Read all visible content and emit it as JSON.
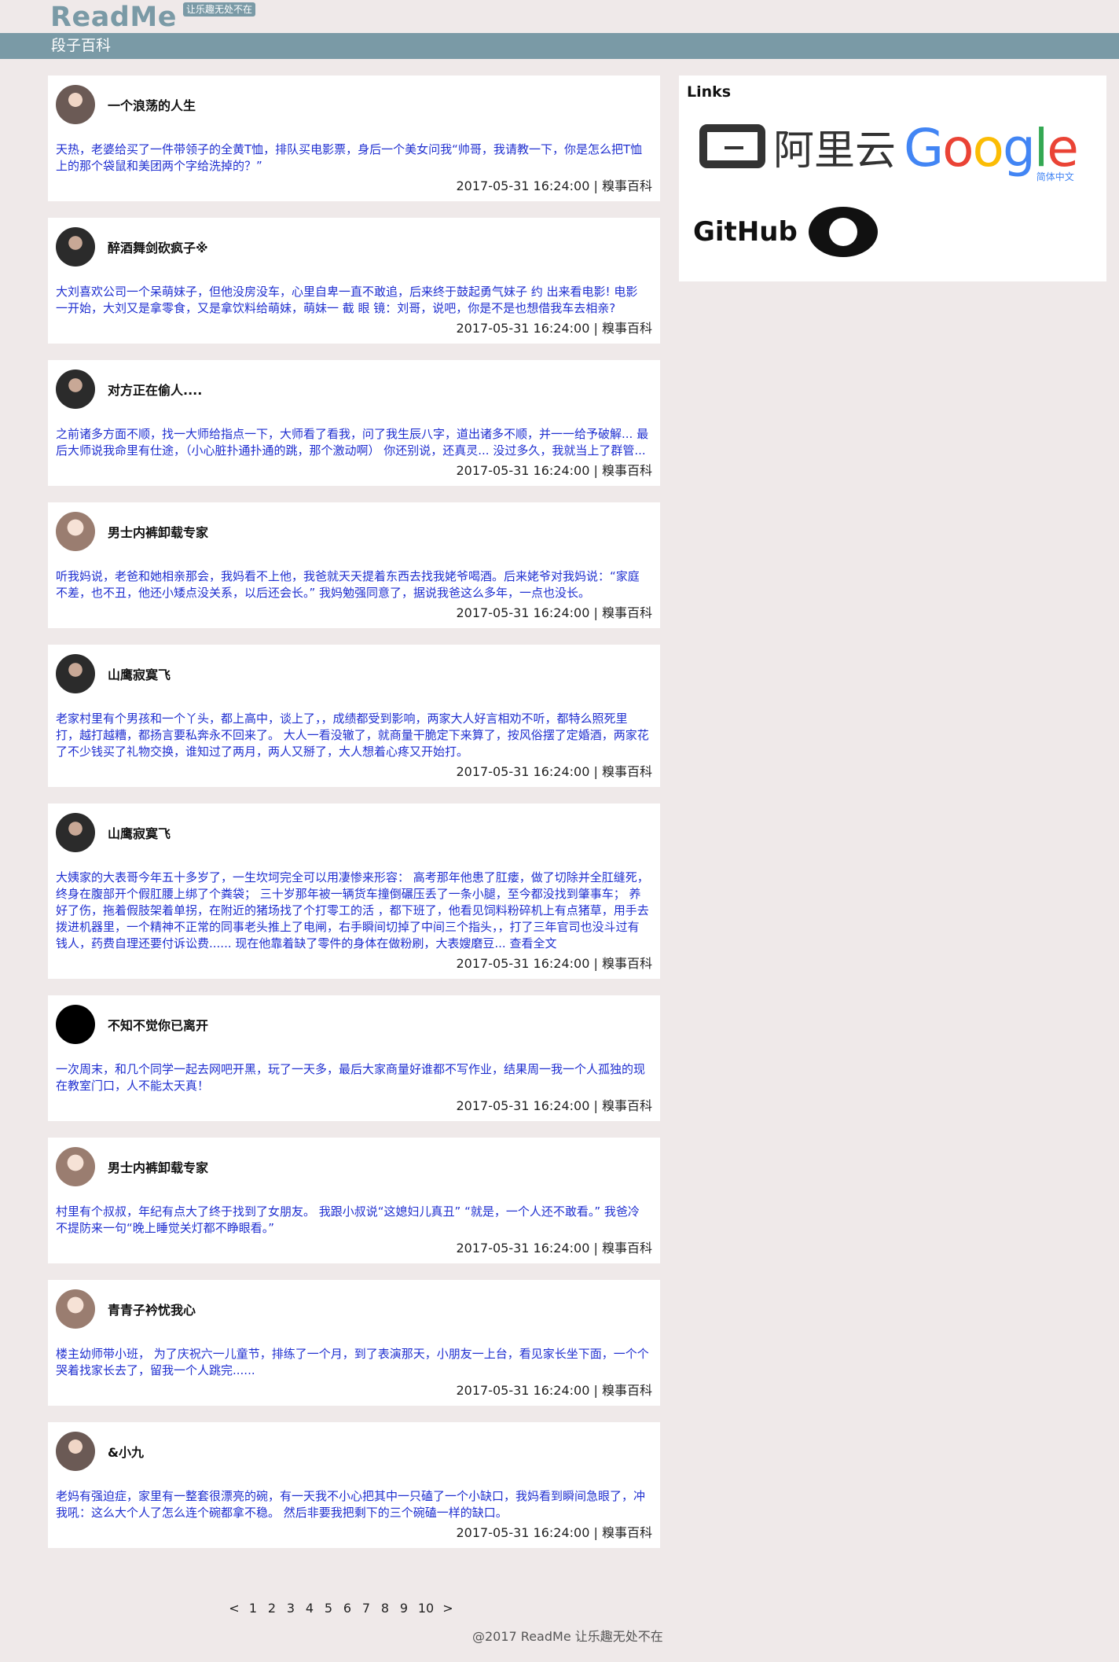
{
  "header": {
    "brand": "ReadMe",
    "slogan": "让乐趣无处不在",
    "nav_title": "段子百科"
  },
  "posts": [
    {
      "author": "一个浪荡的人生",
      "avatar": "avatar-icon",
      "content": "天热，老婆给买了一件带领子的全黄T恤，排队买电影票，身后一个美女问我“帅哥，我请教一下，你是怎么把T恤上的那个袋鼠和美团两个字给洗掉的？”",
      "time": "2017-05-31 16:24:00",
      "source": "糗事百科"
    },
    {
      "author": "醉酒舞剑砍疯子※",
      "avatar": "avatar-icon",
      "content": "大刘喜欢公司一个呆萌妹子，但他没房没车，心里自卑一直不敢追，后来终于鼓起勇气妹子 约 出来看电影! 电影一开始，大刘又是拿零食，又是拿饮料给萌妹，萌妹一 截 眼 镜：刘哥，说吧，你是不是也想借我车去相亲?",
      "time": "2017-05-31 16:24:00",
      "source": "糗事百科"
    },
    {
      "author": "对方正在偷人....",
      "avatar": "avatar-icon",
      "content": "之前诸多方面不顺，找一大师给指点一下，大师看了看我，问了我生辰八字，道出诸多不顺，并一一给予破解... 最后大师说我命里有仕途，（小心脏扑通扑通的跳，那个激动啊） 你还别说，还真灵... 没过多久，我就当上了群管...",
      "time": "2017-05-31 16:24:00",
      "source": "糗事百科"
    },
    {
      "author": "男士内裤卸载专家",
      "avatar": "avatar-icon",
      "content": "听我妈说，老爸和她相亲那会，我妈看不上他，我爸就天天提着东西去找我姥爷喝酒。后来姥爷对我妈说：“家庭不差，也不丑，他还小矮点没关系，以后还会长。” 我妈勉强同意了，据说我爸这么多年，一点也没长。",
      "time": "2017-05-31 16:24:00",
      "source": "糗事百科"
    },
    {
      "author": "山鹰寂寞飞",
      "avatar": "avatar-icon",
      "content": "老家村里有个男孩和一个丫头，都上高中，谈上了，，成绩都受到影响，两家大人好言相劝不听，都特么照死里打，越打越糟，都扬言要私奔永不回来了。 大人一看没辙了，就商量干脆定下来算了，按风俗摆了定婚酒，两家花了不少钱买了礼物交换，谁知过了两月，两人又掰了，大人想着心疼又开始打。",
      "time": "2017-05-31 16:24:00",
      "source": "糗事百科"
    },
    {
      "author": "山鹰寂寞飞",
      "avatar": "avatar-icon",
      "content": "大姨家的大表哥今年五十多岁了，一生坎坷完全可以用凄惨来形容： 高考那年他患了肛瘘，做了切除并全肛缝死，终身在腹部开个假肛腰上绑了个粪袋； 三十岁那年被一辆货车撞倒碾压丢了一条小腿，至今都没找到肇事车； 养好了伤，拖着假肢架着单拐，在附近的猪场找了个打零工的活 ，都下班了，他看见饲料粉碎机上有点猪草，用手去拨进机器里，一个精神不正常的同事老头推上了电闸，右手瞬间切掉了中间三个指头，，打了三年官司也没斗过有钱人，药费自理还要付诉讼费...... 现在他靠着缺了零件的身体在做粉刷，大表嫂磨豆... 查看全文",
      "time": "2017-05-31 16:24:00",
      "source": "糗事百科"
    },
    {
      "author": "不知不觉你已离开",
      "avatar": "avatar-icon",
      "content": "一次周末，和几个同学一起去网吧开黑，玩了一天多，最后大家商量好谁都不写作业，结果周一我一个人孤独的现在教室门口，人不能太天真！",
      "time": "2017-05-31 16:24:00",
      "source": "糗事百科"
    },
    {
      "author": "男士内裤卸载专家",
      "avatar": "avatar-icon",
      "content": "村里有个叔叔，年纪有点大了终于找到了女朋友。 我跟小叔说“这媳妇儿真丑” “就是，一个人还不敢看。” 我爸冷不提防来一句“晚上睡觉关灯都不睁眼看。”",
      "time": "2017-05-31 16:24:00",
      "source": "糗事百科"
    },
    {
      "author": "青青子衿忧我心",
      "avatar": "avatar-icon",
      "content": "楼主幼师带小班， 为了庆祝六一儿童节，排练了一个月，到了表演那天，小朋友一上台，看见家长坐下面，一个个哭着找家长去了，留我一个人跳完......",
      "time": "2017-05-31 16:24:00",
      "source": "糗事百科"
    },
    {
      "author": "&小九",
      "avatar": "avatar-icon",
      "content": "老妈有强迫症，家里有一整套很漂亮的碗，有一天我不小心把其中一只磕了一个小缺口，我妈看到瞬间急眼了，冲我吼：这么大个人了怎么连个碗都拿不稳。 然后非要我把剩下的三个碗磕一样的缺口。",
      "time": "2017-05-31 16:24:00",
      "source": "糗事百科"
    }
  ],
  "sidebar": {
    "title": "Links",
    "aliyun_text": "阿里云",
    "google_text": "Google",
    "google_sub": "简体中文",
    "github_text": "GitHub"
  },
  "pagination": {
    "prev": "<",
    "pages": [
      "1",
      "2",
      "3",
      "4",
      "5",
      "6",
      "7",
      "8",
      "9",
      "10"
    ],
    "next": ">"
  },
  "footer": {
    "text": "@2017 ReadMe 让乐趣无处不在"
  },
  "colors": {
    "accent": "#7a9aa6",
    "background": "#efe9e9",
    "content_text": "#1f2fd0"
  }
}
